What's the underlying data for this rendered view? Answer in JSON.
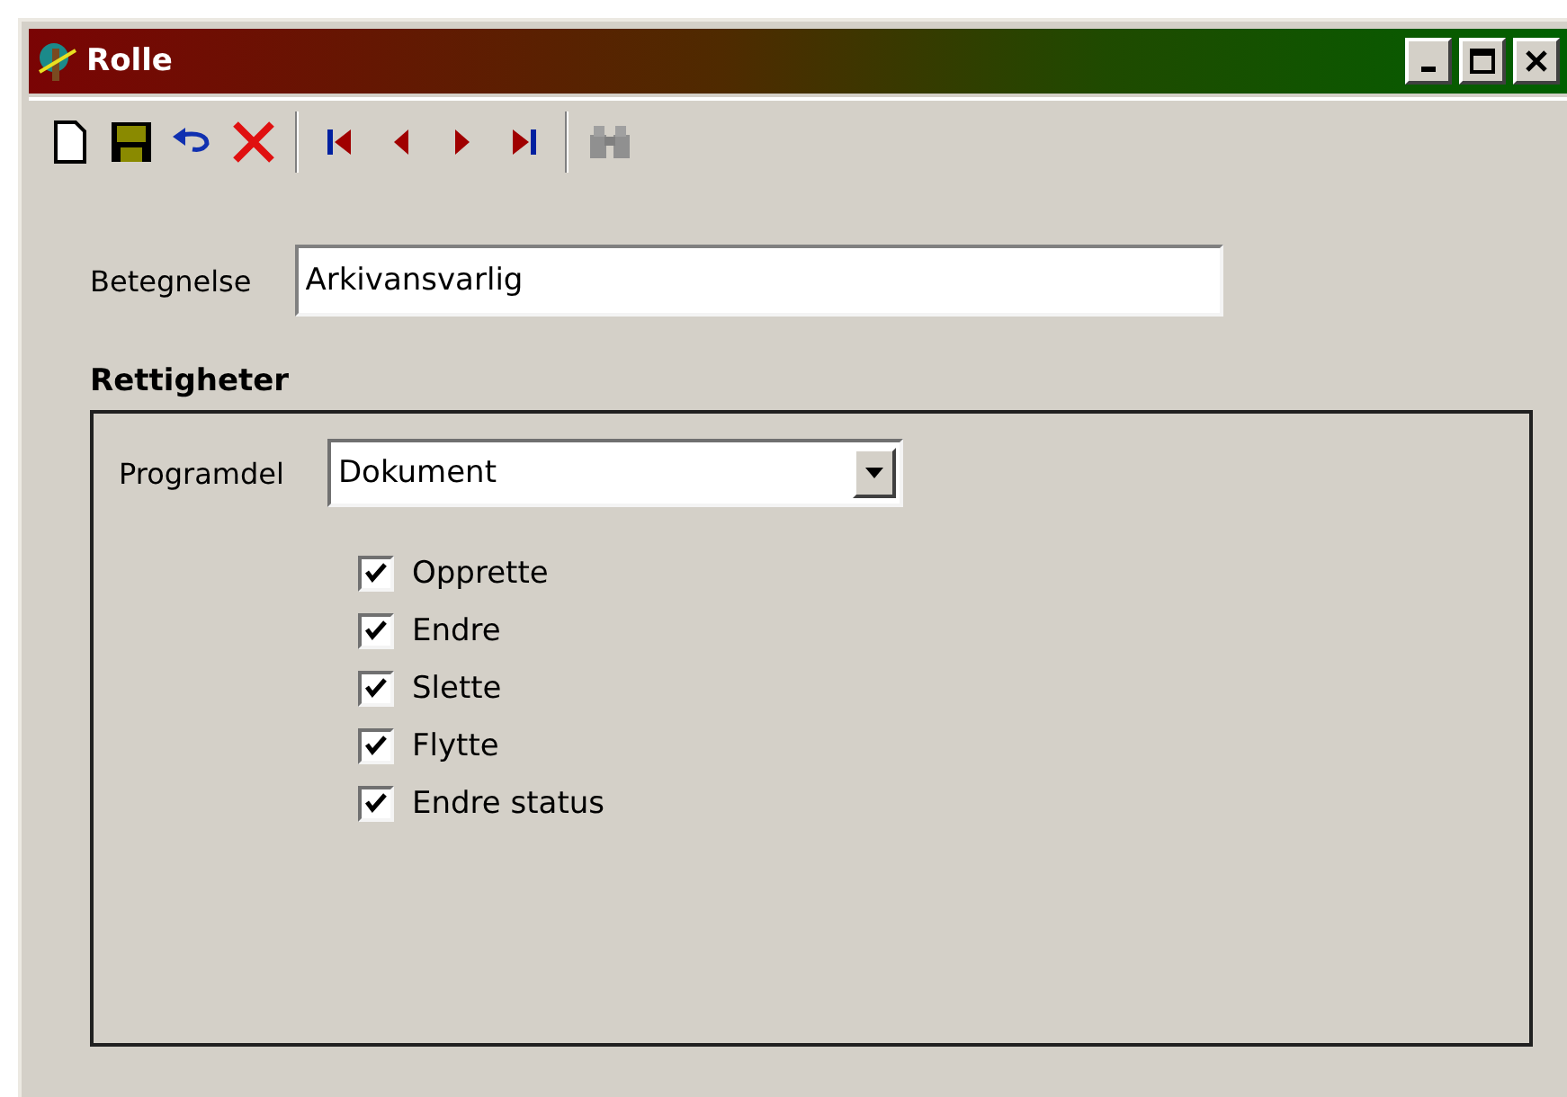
{
  "window": {
    "title": "Rolle"
  },
  "name_field": {
    "label": "Betegnelse",
    "value": "Arkivansvarlig"
  },
  "rights": {
    "title": "Rettigheter",
    "module_label": "Programdel",
    "module_value": "Dokument",
    "permissions": [
      {
        "label": "Opprette",
        "checked": true
      },
      {
        "label": "Endre",
        "checked": true
      },
      {
        "label": "Slette",
        "checked": true
      },
      {
        "label": "Flytte",
        "checked": true
      },
      {
        "label": "Endre status",
        "checked": true
      }
    ]
  }
}
